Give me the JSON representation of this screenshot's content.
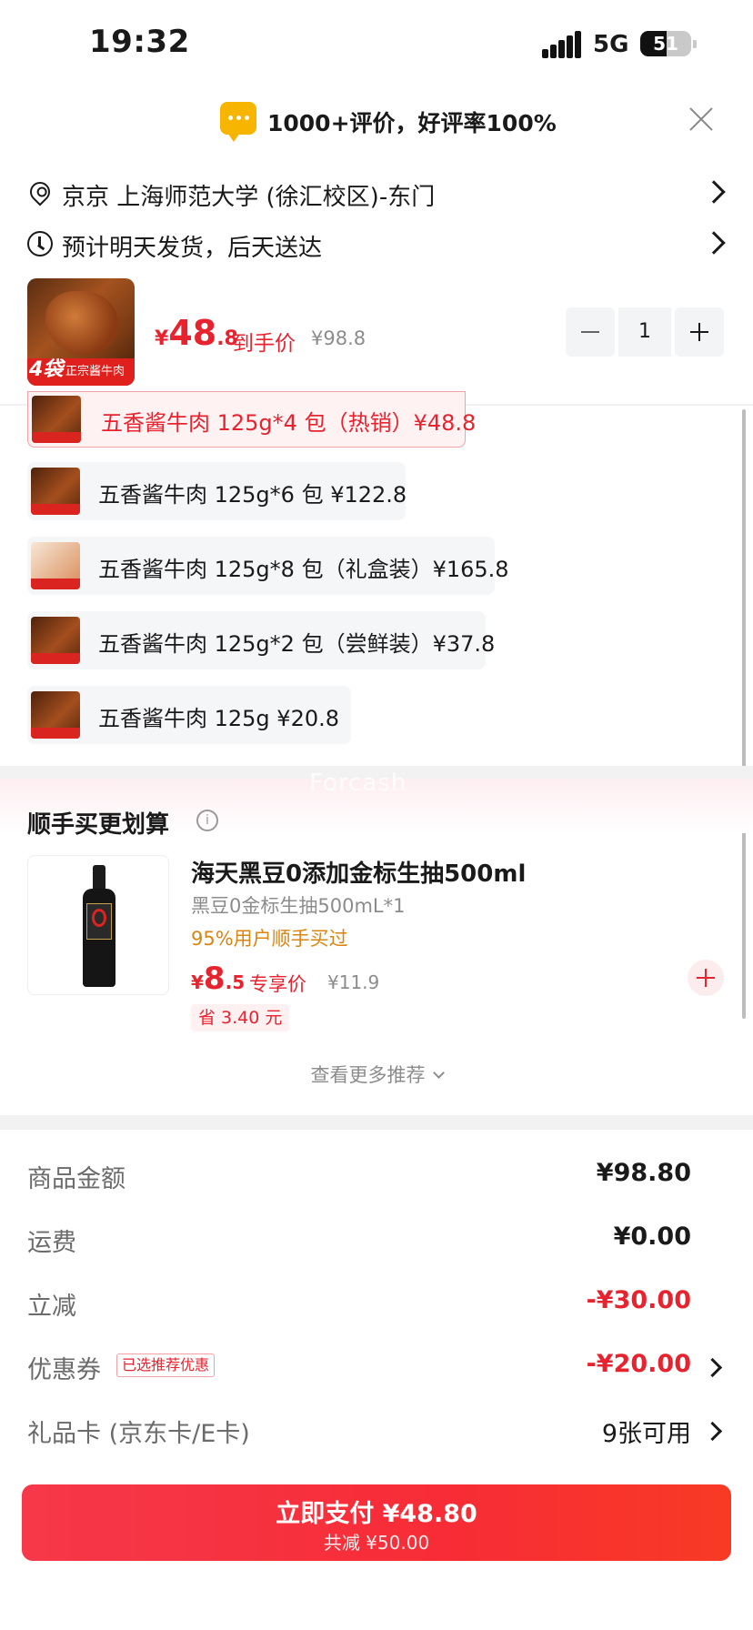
{
  "status_bar": {
    "time": "19:32",
    "network": "5G",
    "battery": "51"
  },
  "review_banner": {
    "text": "1000+评价，好评率100%"
  },
  "address": {
    "text": "京京  上海师范大学 (徐汇校区)-东门"
  },
  "delivery": {
    "text": "预计明天发货，后天送达"
  },
  "selected_product": {
    "thumb_tag": "4袋",
    "thumb_label": "正宗酱牛肉",
    "price_currency": "¥",
    "price_int": "48",
    "price_dec": ".8",
    "price_label": "到手价",
    "original_price": "¥98.8",
    "quantity": "1"
  },
  "sku_options": [
    {
      "label": "五香酱牛肉 125g*4 包（热销）¥48.8",
      "selected": true
    },
    {
      "label": "五香酱牛肉 125g*6 包   ¥122.8",
      "selected": false
    },
    {
      "label": "五香酱牛肉 125g*8 包（礼盒装）¥165.8",
      "selected": false
    },
    {
      "label": "五香酱牛肉 125g*2 包（尝鲜装）¥37.8",
      "selected": false
    },
    {
      "label": "五香酱牛肉 125g   ¥20.8",
      "selected": false
    }
  ],
  "watermark": "Forcash",
  "bundle": {
    "title": "顺手买更划算",
    "info_icon": "i",
    "name": "海天黑豆0添加金标生抽500ml",
    "spec": "黑豆0金标生抽500mL*1",
    "buy_rate": "95%用户顺手买过",
    "price_currency": "¥",
    "price_int": "8",
    "price_dec": ".5",
    "price_label": "专享价",
    "original_price": "¥11.9",
    "save": "省 3.40 元",
    "more": "查看更多推荐"
  },
  "summary": {
    "goods_label": "商品金额",
    "goods_value": "¥98.80",
    "shipping_label": "运费",
    "shipping_value": "¥0.00",
    "discount_label": "立减",
    "discount_value": "-¥30.00",
    "coupon_label": "优惠券",
    "coupon_tag": "已选推荐优惠",
    "coupon_value": "-¥20.00",
    "giftcard_label": "礼品卡 (京东卡/E卡)",
    "giftcard_value": "9张可用"
  },
  "pay_button": {
    "main": "立即支付 ¥48.80",
    "sub": "共减 ¥50.00"
  },
  "colors": {
    "accent_red": "#e6232e",
    "warning_orange": "#d98512",
    "review_yellow": "#f7b500"
  }
}
